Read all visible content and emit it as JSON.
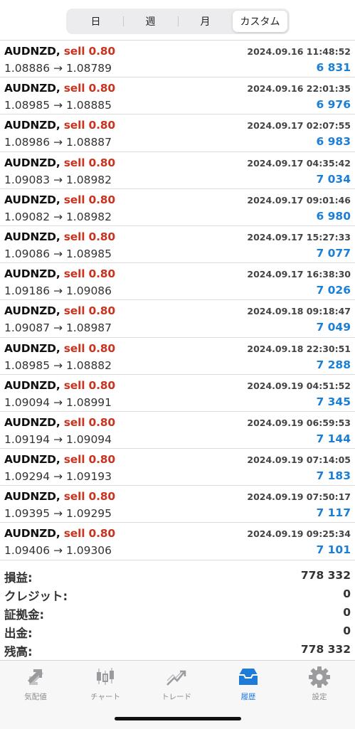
{
  "periods": {
    "tabs": [
      "日",
      "週",
      "月",
      "カスタム"
    ],
    "active": "カスタム"
  },
  "trades": [
    {
      "symbol": "AUDNZD,",
      "side": "sell 0.80",
      "time": "2024.09.16 11:48:52",
      "prices": "1.08886 → 1.08789",
      "profit": "6 831"
    },
    {
      "symbol": "AUDNZD,",
      "side": "sell 0.80",
      "time": "2024.09.16 22:01:35",
      "prices": "1.08985 → 1.08885",
      "profit": "6 976"
    },
    {
      "symbol": "AUDNZD,",
      "side": "sell 0.80",
      "time": "2024.09.17 02:07:55",
      "prices": "1.08986 → 1.08887",
      "profit": "6 983"
    },
    {
      "symbol": "AUDNZD,",
      "side": "sell 0.80",
      "time": "2024.09.17 04:35:42",
      "prices": "1.09083 → 1.08982",
      "profit": "7 034"
    },
    {
      "symbol": "AUDNZD,",
      "side": "sell 0.80",
      "time": "2024.09.17 09:01:46",
      "prices": "1.09082 → 1.08982",
      "profit": "6 980"
    },
    {
      "symbol": "AUDNZD,",
      "side": "sell 0.80",
      "time": "2024.09.17 15:27:33",
      "prices": "1.09086 → 1.08985",
      "profit": "7 077"
    },
    {
      "symbol": "AUDNZD,",
      "side": "sell 0.80",
      "time": "2024.09.17 16:38:30",
      "prices": "1.09186 → 1.09086",
      "profit": "7 026"
    },
    {
      "symbol": "AUDNZD,",
      "side": "sell 0.80",
      "time": "2024.09.18 09:18:47",
      "prices": "1.09087 → 1.08987",
      "profit": "7 049"
    },
    {
      "symbol": "AUDNZD,",
      "side": "sell 0.80",
      "time": "2024.09.18 22:30:51",
      "prices": "1.08985 → 1.08882",
      "profit": "7 288"
    },
    {
      "symbol": "AUDNZD,",
      "side": "sell 0.80",
      "time": "2024.09.19 04:51:52",
      "prices": "1.09094 → 1.08991",
      "profit": "7 345"
    },
    {
      "symbol": "AUDNZD,",
      "side": "sell 0.80",
      "time": "2024.09.19 06:59:53",
      "prices": "1.09194 → 1.09094",
      "profit": "7 144"
    },
    {
      "symbol": "AUDNZD,",
      "side": "sell 0.80",
      "time": "2024.09.19 07:14:05",
      "prices": "1.09294 → 1.09193",
      "profit": "7 183"
    },
    {
      "symbol": "AUDNZD,",
      "side": "sell 0.80",
      "time": "2024.09.19 07:50:17",
      "prices": "1.09395 → 1.09295",
      "profit": "7 117"
    },
    {
      "symbol": "AUDNZD,",
      "side": "sell 0.80",
      "time": "2024.09.19 09:25:34",
      "prices": "1.09406 → 1.09306",
      "profit": "7 101"
    }
  ],
  "summary": [
    {
      "label": "損益:",
      "value": "778 332"
    },
    {
      "label": "クレジット:",
      "value": "0"
    },
    {
      "label": "証拠金:",
      "value": "0"
    },
    {
      "label": "出金:",
      "value": "0"
    },
    {
      "label": "残高:",
      "value": "778 332"
    }
  ],
  "tabbar": [
    {
      "label": "気配値",
      "icon": "quotes-icon"
    },
    {
      "label": "チャート",
      "icon": "chart-icon"
    },
    {
      "label": "トレード",
      "icon": "trade-icon"
    },
    {
      "label": "履歴",
      "icon": "history-icon",
      "active": true
    },
    {
      "label": "設定",
      "icon": "settings-icon"
    }
  ],
  "colors": {
    "sell": "#c8341f",
    "profit": "#1b7fd6",
    "active_tab": "#1f7bd8",
    "inactive_tab": "#8e8e93"
  }
}
